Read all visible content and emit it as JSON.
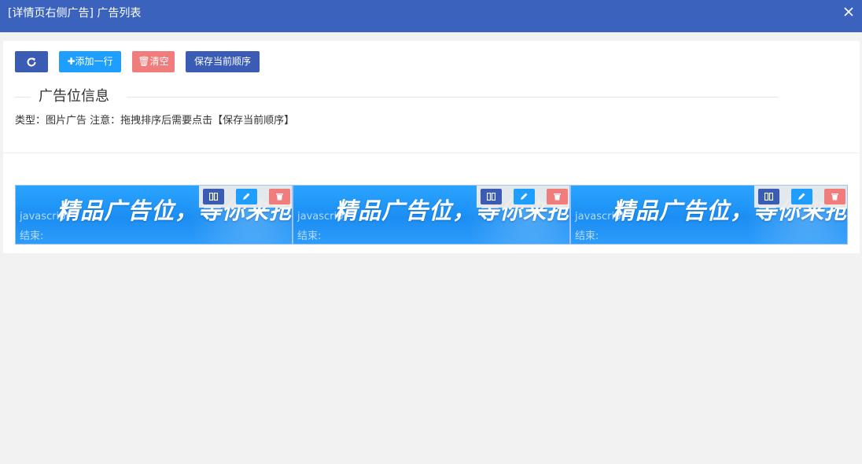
{
  "window": {
    "title": "[详情页右侧广告] 广告列表",
    "close_icon": "close-icon"
  },
  "toolbar": {
    "refresh_icon": "refresh-icon",
    "add_label": "✚添加一行",
    "clear_label": "🗑清空",
    "save_label": "保存当前顺序"
  },
  "section": {
    "legend": "广告位信息",
    "notice": "类型：图片广告 注意：拖拽排序后需要点击【保存当前顺序】"
  },
  "ads": [
    {
      "banner_text": "精品广告位，等你来抢",
      "link_text": "javascript",
      "end_label": "结束:"
    },
    {
      "banner_text": "精品广告位，等你来抢",
      "link_text": "javascript",
      "end_label": "结束:"
    },
    {
      "banner_text": "精品广告位，等你来抢",
      "link_text": "javascript",
      "end_label": "结束:"
    }
  ],
  "colors": {
    "titlebar": "#3b63bd",
    "primary": "#3b5cb5",
    "info": "#1e9fff",
    "danger": "#f07c7c"
  }
}
